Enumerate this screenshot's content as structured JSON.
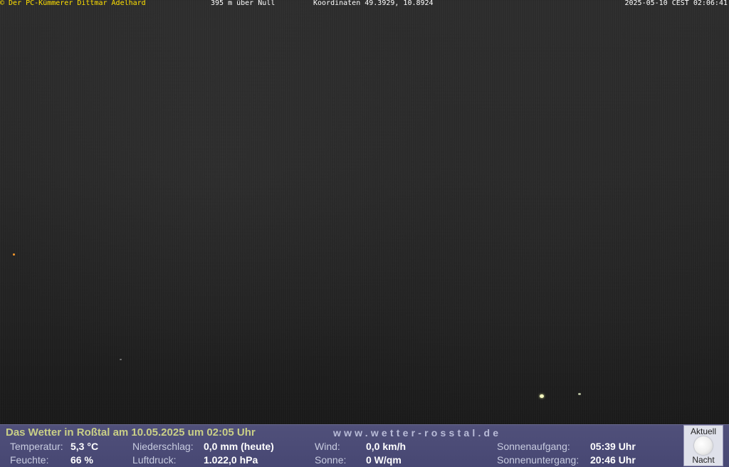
{
  "overlay": {
    "copyright": "© Der PC-Kümmerer Dittmar Adelhard",
    "altitude": "395 m über Null",
    "coordinates": "Koordinaten 49.3929, 10.8924",
    "timestamp": "2025-05-10 CEST 02:06:41"
  },
  "weather": {
    "title": "Das Wetter in Roßtal am 10.05.2025 um 02:05 Uhr",
    "url": "www.wetter-rosstal.de",
    "temperature_label": "Temperatur:",
    "temperature_value": "5,3 °C",
    "humidity_label": "Feuchte:",
    "humidity_value": "66 %",
    "precip_label": "Niederschlag:",
    "precip_value": "0,0 mm (heute)",
    "pressure_label": "Luftdruck:",
    "pressure_value": "1.022,0 hPa",
    "wind_label": "Wind:",
    "wind_value": "0,0 km/h",
    "sun_label": "Sonne:",
    "sun_value": "0 W/qm",
    "sunrise_label": "Sonnenaufgang:",
    "sunrise_value": "05:39 Uhr",
    "sunset_label": "Sonnenuntergang:",
    "sunset_value": "20:46 Uhr"
  },
  "moon": {
    "top_label": "Aktuell",
    "bottom_label": "Nacht",
    "icon": "full-moon-icon"
  }
}
